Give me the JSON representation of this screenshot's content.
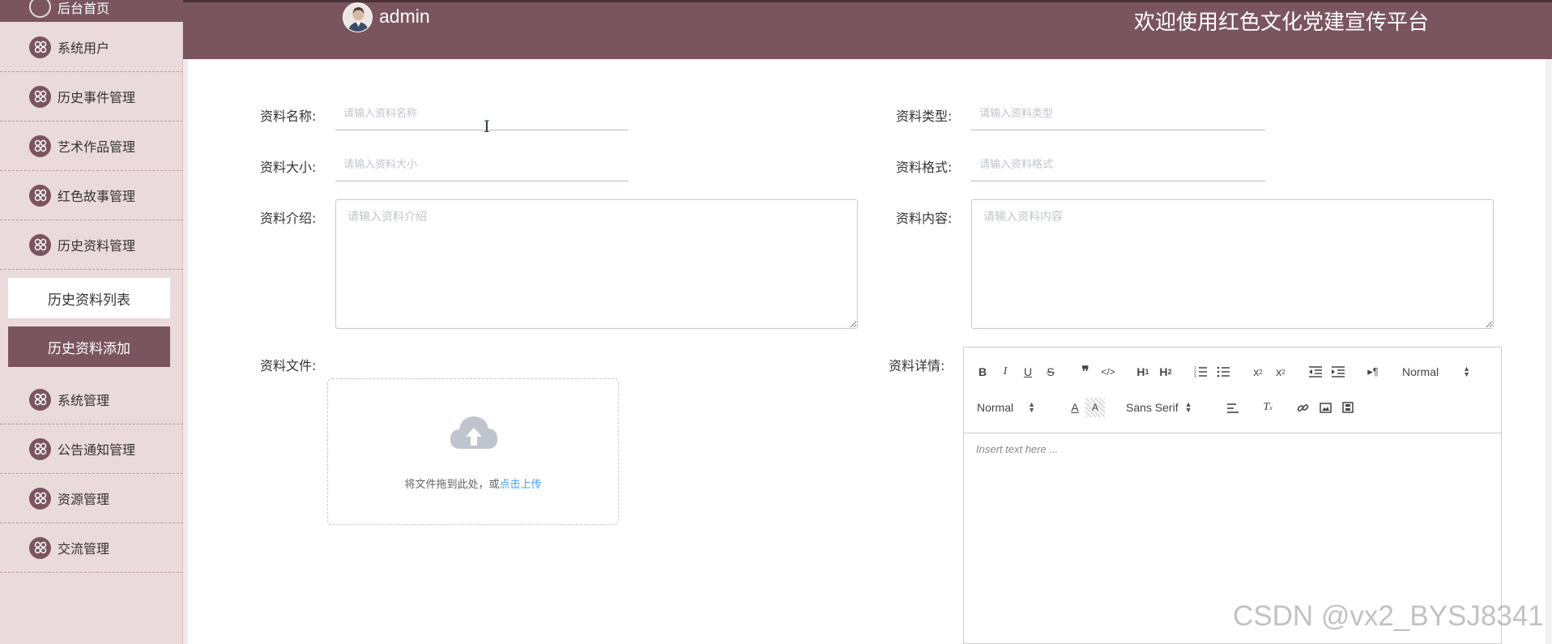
{
  "sidebar": {
    "top_item": "后台首页",
    "items": [
      {
        "label": "系统用户"
      },
      {
        "label": "历史事件管理"
      },
      {
        "label": "艺术作品管理"
      },
      {
        "label": "红色故事管理"
      },
      {
        "label": "历史资料管理"
      },
      {
        "label": "系统管理"
      },
      {
        "label": "公告通知管理"
      },
      {
        "label": "资源管理"
      },
      {
        "label": "交流管理"
      }
    ],
    "sub_items": [
      {
        "label": "历史资料列表"
      },
      {
        "label": "历史资料添加"
      }
    ]
  },
  "header": {
    "username": "admin",
    "title": "欢迎使用红色文化党建宣传平台"
  },
  "form": {
    "name_label": "资料名称:",
    "name_placeholder": "请输入资料名称",
    "type_label": "资料类型:",
    "type_placeholder": "请输入资料类型",
    "size_label": "资料大小:",
    "size_placeholder": "请输入资料大小",
    "format_label": "资料格式:",
    "format_placeholder": "请输入资料格式",
    "intro_label": "资料介绍:",
    "intro_placeholder": "请输入资料介绍",
    "content_label": "资料内容:",
    "content_placeholder": "请输入资料内容",
    "file_label": "资料文件:",
    "upload_text": "将文件拖到此处，或",
    "upload_link": "点击上传",
    "detail_label": "资料详情:"
  },
  "editor": {
    "header_select": "Normal",
    "size_select": "Normal",
    "font_select": "Sans Serif",
    "placeholder": "Insert text here ..."
  },
  "watermark": "CSDN @vx2_BYSJ8341",
  "colors": {
    "primary": "#7a5560",
    "sidebar_bg": "#ebdadb",
    "link": "#409eff"
  }
}
